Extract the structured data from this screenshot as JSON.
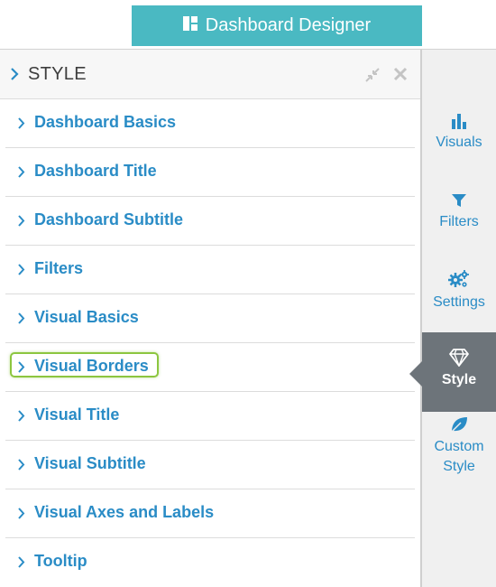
{
  "header": {
    "title": "Dashboard Designer",
    "accent": "#4ab9c2"
  },
  "panel": {
    "title": "STYLE",
    "icons": [
      "collapse-icon",
      "close-icon"
    ],
    "sections": [
      {
        "label": "Dashboard Basics"
      },
      {
        "label": "Dashboard Title"
      },
      {
        "label": "Dashboard Subtitle"
      },
      {
        "label": "Filters"
      },
      {
        "label": "Visual Basics"
      },
      {
        "label": "Visual Borders",
        "highlighted": true
      },
      {
        "label": "Visual Title"
      },
      {
        "label": "Visual Subtitle"
      },
      {
        "label": "Visual Axes and Labels"
      },
      {
        "label": "Tooltip"
      }
    ],
    "label_color": "#2a8cc6",
    "highlight_color": "#8cc63f"
  },
  "tabs": [
    {
      "label": "Visuals",
      "icon": "bar-chart-icon"
    },
    {
      "label": "Filters",
      "icon": "filter-icon"
    },
    {
      "label": "Settings",
      "icon": "gears-icon"
    },
    {
      "label": "Style",
      "icon": "diamond-icon",
      "active": true
    },
    {
      "label_line1": "Custom",
      "label_line2": "Style",
      "icon": "leaf-icon"
    }
  ],
  "active_tab_color": "#6d747a"
}
